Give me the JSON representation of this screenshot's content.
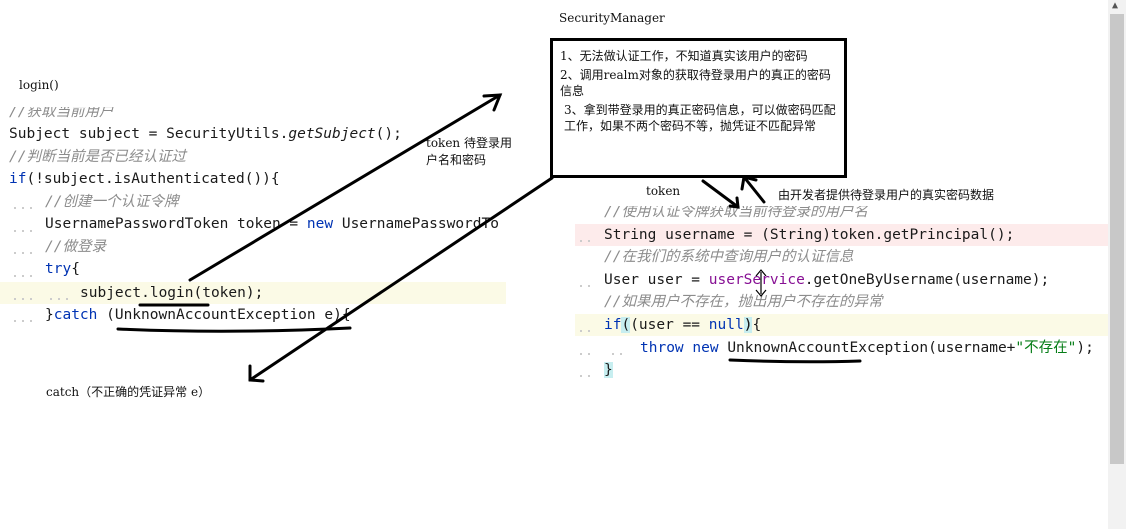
{
  "labels": {
    "security_manager": "SecurityManager",
    "login": "login()",
    "token_pass": "token 待登录用户名和密码",
    "token_pass_line1": "token 待登录用",
    "token_pass_line2": "户名和密码",
    "token": "token",
    "realm_provides": "由开发者提供待登录用户的真实密码数据",
    "catch_note": "catch（不正确的凭证异常 e）"
  },
  "box": {
    "item1": "1、无法做认证工作，不知道真实该用户的密码",
    "item2": "2、调用realm对象的获取待登录用户的真正的密码信息",
    "item3": "3、拿到带登录用的真正密码信息，可以做密码匹配工作，如果不两个密码不等，抛凭证不匹配异常"
  },
  "left_code": {
    "c1": "//获取当前用户",
    "l1": "Subject subject = SecurityUtils.",
    "l1m": "getSubject",
    "l1e": "();",
    "c2": "//判断当前是否已经认证过",
    "l2k": "if",
    "l2": "(!subject.isAuthenticated()){",
    "c3": "//创建一个认证令牌",
    "l3": "UsernamePasswordToken token = ",
    "l3k": "new",
    "l3e": " UsernamePasswordTo",
    "c4": "//做登录",
    "l4k": "try",
    "l4": "{",
    "l5": "subject.login(token);",
    "l6a": "}",
    "l6k": "catch",
    "l6": " (UnknownAccountException e){"
  },
  "right_code": {
    "c1": "//使用认证令牌获取当前待登录的用户名",
    "l1": "String username = (String)token.getPrincipal();",
    "c2": "//在我们的系统中查询用户的认证信息",
    "l2a": "User user = ",
    "l2p": "userService",
    "l2b": ".getOneByUsername(username);",
    "c3": "//如果用户不存在，抛出用户不存在的异常",
    "l3k": "if",
    "l3a": "(user == ",
    "l3n": "null",
    "l3b": "){",
    "l4k1": "throw",
    "l4k2": "new",
    "l4a": " UnknownAccountException(username+",
    "l4s": "\"不存在\"",
    "l4b": ");",
    "l5": "}"
  }
}
